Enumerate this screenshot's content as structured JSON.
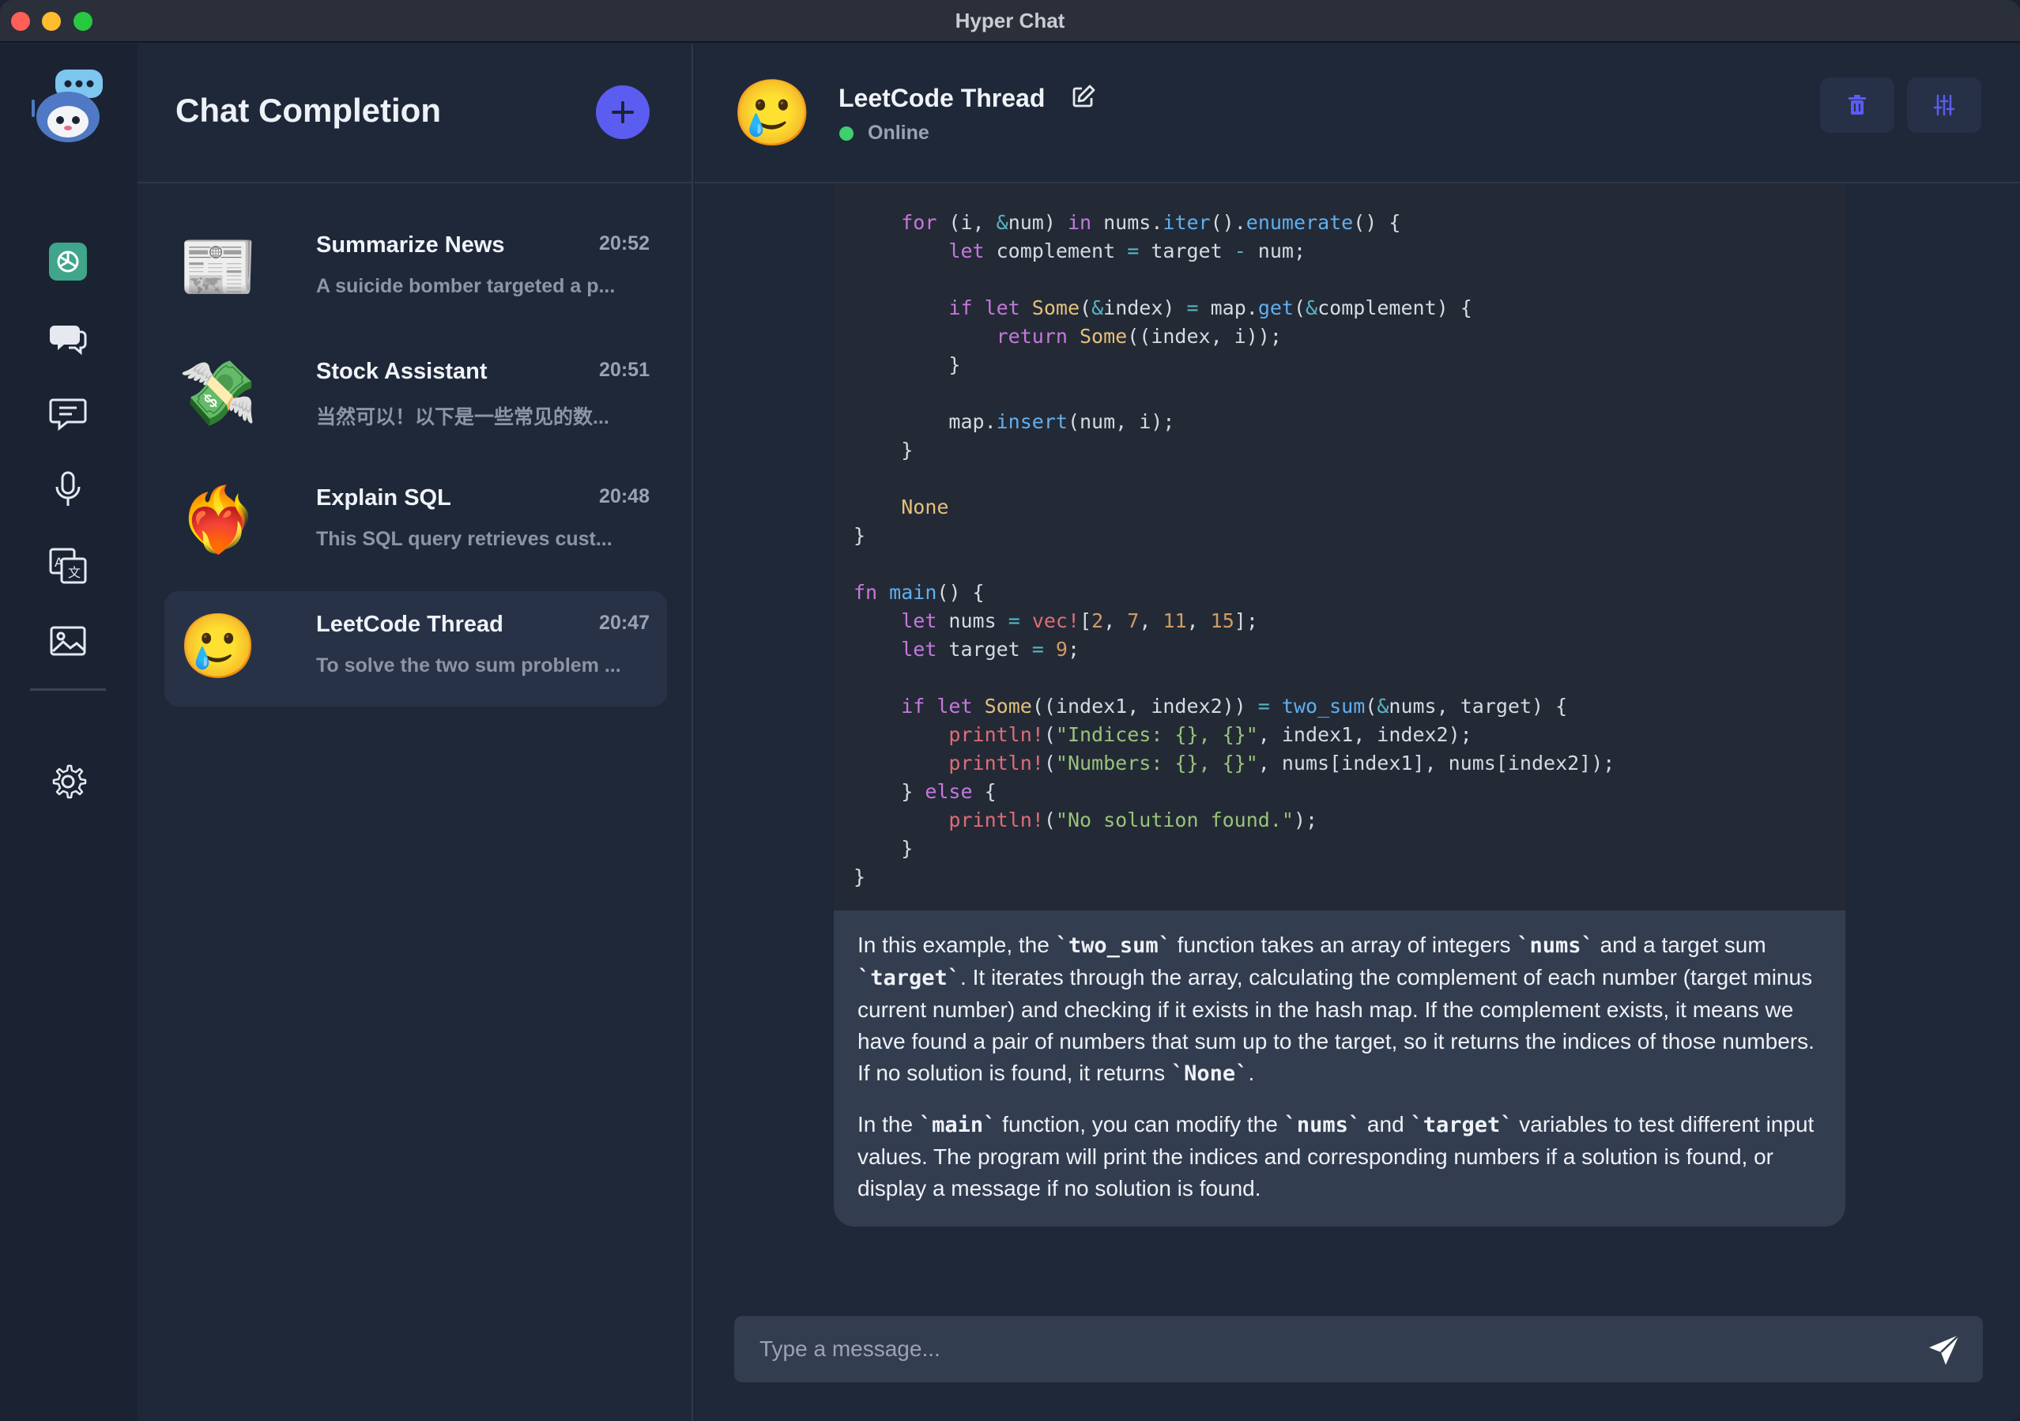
{
  "window": {
    "title": "Hyper Chat"
  },
  "sidebar": {
    "title": "Chat Completion",
    "chats": [
      {
        "name": "Summarize News",
        "time": "20:52",
        "preview": "A suicide bomber targeted a p...",
        "avatar": "newspaper",
        "avatar_glyph": "📰"
      },
      {
        "name": "Stock Assistant",
        "time": "20:51",
        "preview": "当然可以！以下是一些常见的数...",
        "avatar": "money-with-wings",
        "avatar_glyph": "💸"
      },
      {
        "name": "Explain SQL",
        "time": "20:48",
        "preview": "This SQL query retrieves cust...",
        "avatar": "heart-on-fire",
        "avatar_glyph": "❤️‍🔥"
      },
      {
        "name": "LeetCode Thread",
        "time": "20:47",
        "preview": "To solve the two sum problem ...",
        "avatar": "face-holding-back-tears",
        "avatar_glyph": "🥲",
        "active": true
      }
    ]
  },
  "main": {
    "title": "LeetCode Thread",
    "status": "Online",
    "avatar_glyph": "🥲",
    "paragraph1": [
      "In this example, the ",
      "`two_sum`",
      " function takes an array of integers ",
      "`nums`",
      " and a target sum ",
      "`target`",
      ". It iterates through the array, calculating the complement of each number (target minus current number) and checking if it exists in the hash map. If the complement exists, it means we have found a pair of numbers that sum up to the target, so it returns the indices of those numbers. If no solution is found, it returns ",
      "`None`",
      "."
    ],
    "paragraph2": [
      "In the ",
      "`main`",
      " function, you can modify the ",
      "`nums`",
      " and ",
      "`target`",
      " variables to test different input values. The program will print the indices and corresponding numbers if a solution is found, or display a message if no solution is found."
    ],
    "composer_placeholder": "Type a message..."
  },
  "colors": {
    "accent": "#5b5cf0",
    "online": "#3ecf6e",
    "background": "#1f2839"
  }
}
